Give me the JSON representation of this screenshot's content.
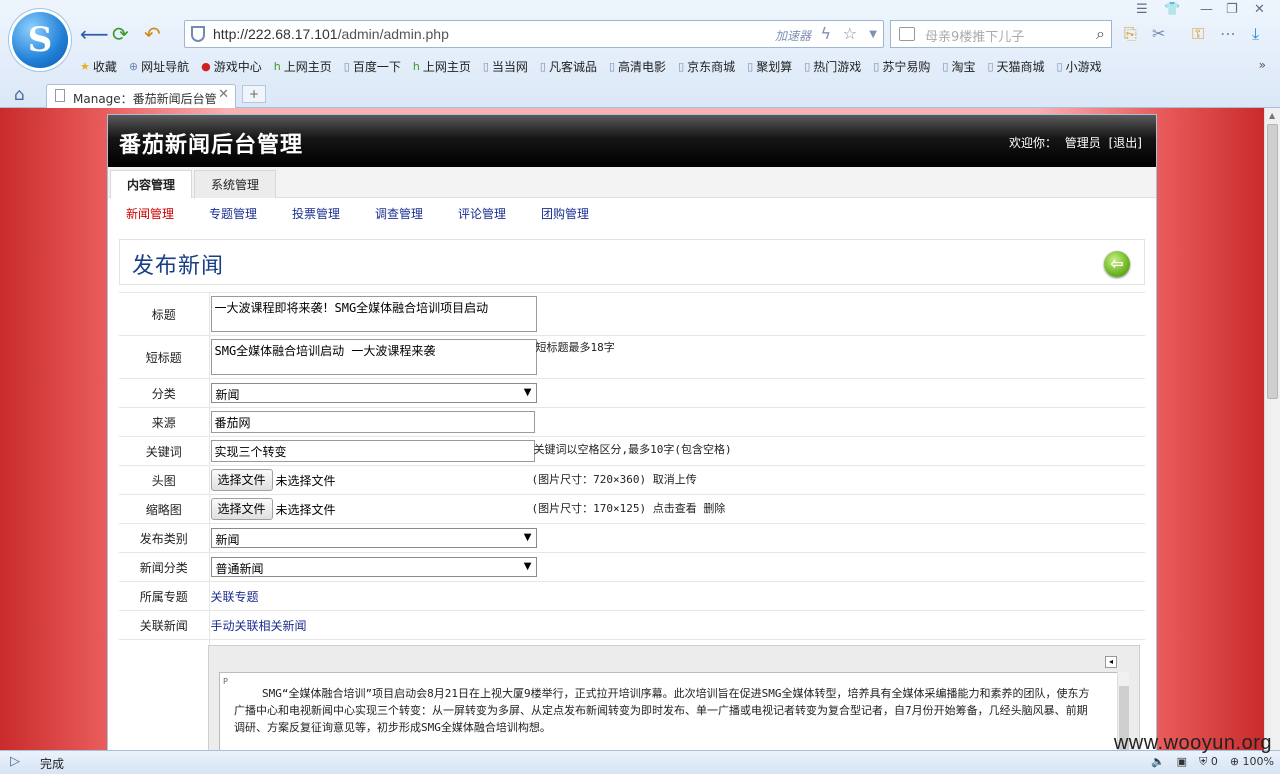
{
  "browser": {
    "url_host": "http://222.68.17.101",
    "url_path": "/admin/admin.php",
    "accelerator_label": "加速器",
    "search_placeholder": "母亲9楼推下儿子",
    "tab_title": "Manage：番茄新闻后台管",
    "new_tab_label": "+",
    "bookmarks": [
      {
        "icon": "star-icon",
        "label": "收藏"
      },
      {
        "icon": "globe-icon",
        "label": "网址导航"
      },
      {
        "icon": "game-icon",
        "label": "游戏中心"
      },
      {
        "icon": "hao-icon",
        "label": "上网主页"
      },
      {
        "icon": "page-icon",
        "label": "百度一下"
      },
      {
        "icon": "hao-icon",
        "label": "上网主页"
      },
      {
        "icon": "page-icon",
        "label": "当当网"
      },
      {
        "icon": "page-icon",
        "label": "凡客诚品"
      },
      {
        "icon": "page-icon",
        "label": "高清电影"
      },
      {
        "icon": "page-icon",
        "label": "京东商城"
      },
      {
        "icon": "page-icon",
        "label": "聚划算"
      },
      {
        "icon": "page-icon",
        "label": "热门游戏"
      },
      {
        "icon": "page-icon",
        "label": "苏宁易购"
      },
      {
        "icon": "page-icon",
        "label": "淘宝"
      },
      {
        "icon": "page-icon",
        "label": "天猫商城"
      },
      {
        "icon": "page-icon",
        "label": "小游戏"
      }
    ],
    "status": "完成",
    "status_count": "0",
    "zoom": "100%"
  },
  "admin": {
    "title": "番茄新闻后台管理",
    "welcome": "欢迎你：",
    "user": "管理员",
    "logout": "[退出]",
    "main_tabs": [
      "内容管理",
      "系统管理"
    ],
    "sub_tabs": [
      "新闻管理",
      "专题管理",
      "投票管理",
      "调查管理",
      "评论管理",
      "团购管理"
    ],
    "page_heading": "发布新闻"
  },
  "form": {
    "title_label": "标题",
    "title_value": "一大波课程即将来袭！SMG全媒体融合培训项目启动",
    "short_title_label": "短标题",
    "short_title_value": "SMG全媒体融合培训启动 一大波课程来袭",
    "short_title_hint": "短标题最多18字",
    "category_label": "分类",
    "category_value": "新闻",
    "source_label": "来源",
    "source_value": "番茄网",
    "keywords_label": "关键词",
    "keywords_value": "实现三个转变",
    "keywords_hint": "关键词以空格区分,最多10字(包含空格)",
    "head_image_label": "头图",
    "choose_file": "选择文件",
    "no_file": "未选择文件",
    "head_image_hint": "(图片尺寸：720×360) 取消上传",
    "thumb_label": "缩略图",
    "thumb_hint": "(图片尺寸：170×125) 点击查看 删除",
    "publish_type_label": "发布类别",
    "publish_type_value": "新闻",
    "news_category_label": "新闻分类",
    "news_category_value": "普通新闻",
    "topic_label": "所属专题",
    "topic_link": "关联专题",
    "related_label": "关联新闻",
    "related_link": "手动关联相关新闻",
    "editor_tag": "P",
    "body_text": "SMG“全媒体融合培训”项目启动会8月21日在上视大厦9楼举行，正式拉开培训序幕。此次培训旨在促进SMG全媒体转型，培养具有全媒体采编播能力和素养的团队，使东方广播中心和电视新闻中心实现三个转变：从一屏转变为多屏、从定点发布新闻转变为即时发布、单一广播或电视记者转变为复合型记者，自7月份开始筹备，几经头脑风暴、前期调研、方案反复征询意见等，初步形成SMG全媒体融合培训构想。"
  },
  "watermark": "www.wooyun.org"
}
